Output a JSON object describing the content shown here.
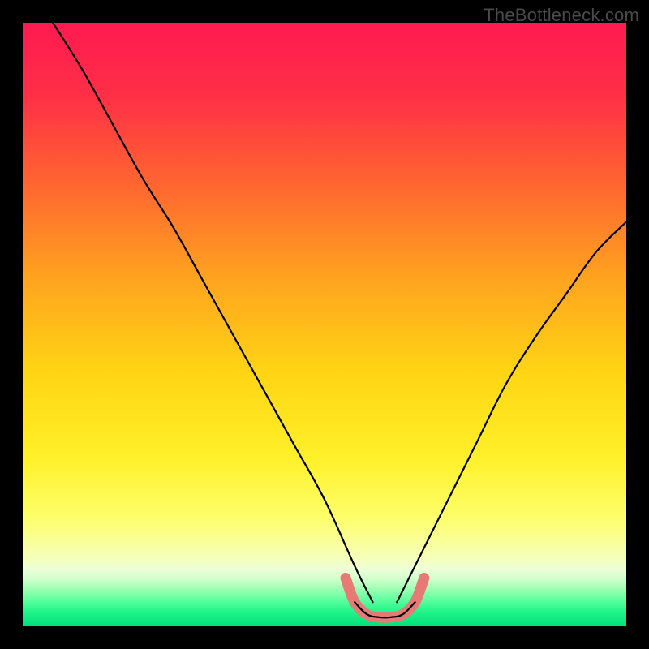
{
  "watermark": "TheBottleneck.com",
  "gradient_stops": [
    {
      "offset": 0.0,
      "color": "#ff1a50"
    },
    {
      "offset": 0.12,
      "color": "#ff2f47"
    },
    {
      "offset": 0.28,
      "color": "#ff6a2e"
    },
    {
      "offset": 0.42,
      "color": "#ffa21f"
    },
    {
      "offset": 0.58,
      "color": "#ffd514"
    },
    {
      "offset": 0.72,
      "color": "#fff029"
    },
    {
      "offset": 0.82,
      "color": "#fdff6a"
    },
    {
      "offset": 0.885,
      "color": "#f6ffb8"
    },
    {
      "offset": 0.905,
      "color": "#edffd6"
    },
    {
      "offset": 0.92,
      "color": "#d6ffcf"
    },
    {
      "offset": 0.935,
      "color": "#a8ffb8"
    },
    {
      "offset": 0.955,
      "color": "#63ffa0"
    },
    {
      "offset": 0.975,
      "color": "#22f58a"
    },
    {
      "offset": 1.0,
      "color": "#00e07a"
    }
  ],
  "chart_data": {
    "type": "line",
    "title": "",
    "xlabel": "",
    "ylabel": "",
    "xlim": [
      0,
      100
    ],
    "ylim": [
      0,
      100
    ],
    "optimum_range_x": [
      55,
      65
    ],
    "optimum_highlight_color": "#e77a74",
    "series": [
      {
        "name": "bottleneck-curve-left",
        "x": [
          5,
          10,
          15,
          20,
          25,
          30,
          35,
          40,
          45,
          50,
          55,
          58
        ],
        "y": [
          100,
          92,
          83,
          74,
          66,
          57,
          48,
          39,
          30,
          21,
          10,
          4
        ]
      },
      {
        "name": "bottleneck-curve-right",
        "x": [
          62,
          65,
          70,
          75,
          80,
          85,
          90,
          95,
          100
        ],
        "y": [
          4,
          10,
          20,
          30,
          40,
          48,
          55,
          62,
          67
        ]
      },
      {
        "name": "bottleneck-flat",
        "x": [
          55,
          57,
          59,
          61,
          63,
          65
        ],
        "y": [
          4,
          2,
          1.5,
          1.5,
          2,
          4
        ]
      }
    ]
  }
}
